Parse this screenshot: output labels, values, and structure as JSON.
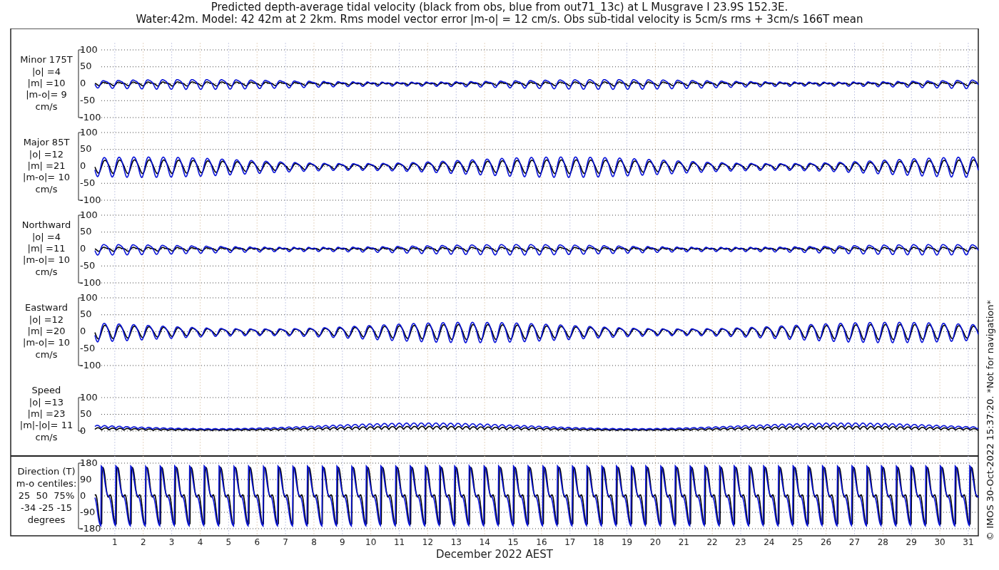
{
  "title": {
    "line_1": "Predicted depth-average tidal velocity (black from obs, blue from out71_13c) at L Musgrave I 23.9S 152.3E.",
    "line_2": "Water:42m. Model: 42 42m at 2 2km. Rms model vector error |m-o| = 12 cm/s. Obs sub-tidal velocity is 5cm/s rms + 3cm/s 166T mean"
  },
  "panels": [
    {
      "kind": "velocity",
      "label_lines": [
        "Minor 175T",
        "|o| =4",
        "|m| =10",
        "|m-o|= 9",
        "cm/s"
      ],
      "yticks": [
        "100",
        "50",
        "0",
        "-50",
        "-100"
      ]
    },
    {
      "kind": "velocity",
      "label_lines": [
        "Major 85T",
        "|o| =12",
        "|m| =21",
        "|m-o|= 10",
        "cm/s"
      ],
      "yticks": [
        "100",
        "50",
        "0",
        "-50",
        "-100"
      ]
    },
    {
      "kind": "velocity",
      "label_lines": [
        "Northward",
        "|o| =4",
        "|m| =11",
        "|m-o|= 10",
        "cm/s"
      ],
      "yticks": [
        "100",
        "50",
        "0",
        "-50",
        "-100"
      ]
    },
    {
      "kind": "velocity",
      "label_lines": [
        "Eastward",
        "|o| =12",
        "|m| =20",
        "|m-o|= 10",
        "cm/s"
      ],
      "yticks": [
        "100",
        "50",
        "0",
        "-50",
        "-100"
      ]
    },
    {
      "kind": "speed",
      "label_lines": [
        "Speed",
        "|o| =13",
        "|m| =23",
        "|m|-|o|= 11",
        "cm/s"
      ],
      "yticks": [
        "100",
        "50",
        "0"
      ]
    },
    {
      "kind": "direction",
      "label_lines": [
        "Direction (T)",
        "m-o centiles:",
        "25  50  75%",
        "-34 -25 -15",
        "degrees"
      ],
      "yticks": [
        "180",
        "90",
        "0",
        "-90",
        "-180"
      ]
    }
  ],
  "x_axis": {
    "day_labels": [
      "1",
      "2",
      "3",
      "4",
      "5",
      "6",
      "7",
      "8",
      "9",
      "10",
      "11",
      "12",
      "13",
      "14",
      "15",
      "16",
      "17",
      "18",
      "19",
      "20",
      "21",
      "22",
      "23",
      "24",
      "25",
      "26",
      "27",
      "28",
      "29",
      "30",
      "31"
    ],
    "label": "December 2022 AEST"
  },
  "footer": "© IMOS 30-Oct-2022 15:37:20. *Not for navigation*"
}
